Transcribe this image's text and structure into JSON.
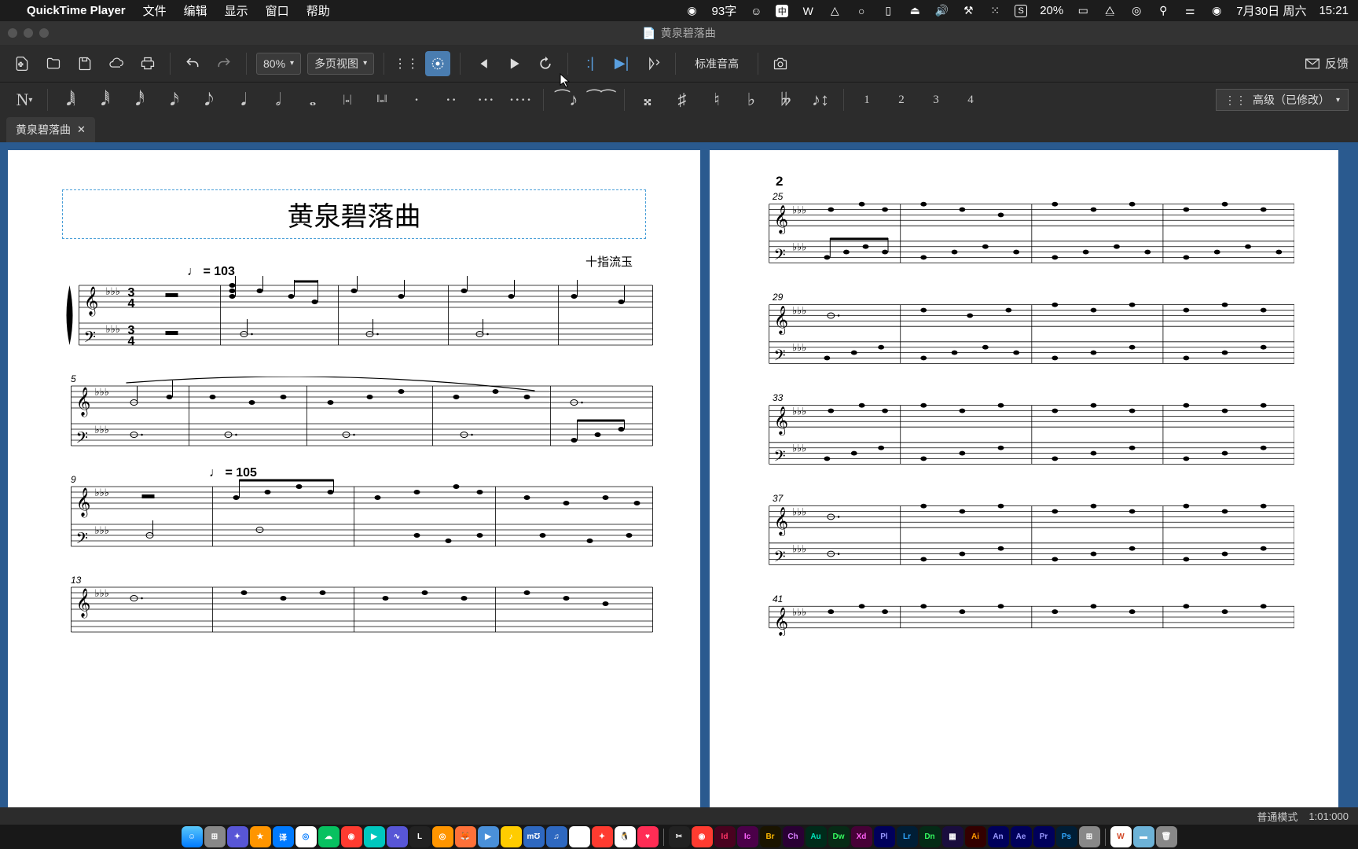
{
  "menubar": {
    "app_name": "QuickTime Player",
    "items": [
      "文件",
      "编辑",
      "显示",
      "窗口",
      "帮助"
    ],
    "status_text": "93字",
    "battery": "20%",
    "date": "7月30日 周六",
    "time": "15:21"
  },
  "window": {
    "title": "黄泉碧落曲"
  },
  "toolbar": {
    "zoom": "80%",
    "view_mode": "多页视图",
    "pitch_label": "标准音高",
    "feedback": "反馈"
  },
  "note_toolbar": {
    "voices": [
      "1",
      "2",
      "3",
      "4"
    ],
    "workspace": "高级（已修改）"
  },
  "tab": {
    "name": "黄泉碧落曲"
  },
  "score": {
    "title": "黄泉碧落曲",
    "composer": "十指流玉",
    "tempo1": "♩ = 103",
    "tempo2": "♩ = 105",
    "page2_num": "2",
    "measures_p1": [
      "5",
      "9",
      "13"
    ],
    "measures_p2": [
      "25",
      "29",
      "33",
      "37",
      "41"
    ]
  },
  "status": {
    "mode": "普通模式",
    "pos": "1:01:000"
  }
}
